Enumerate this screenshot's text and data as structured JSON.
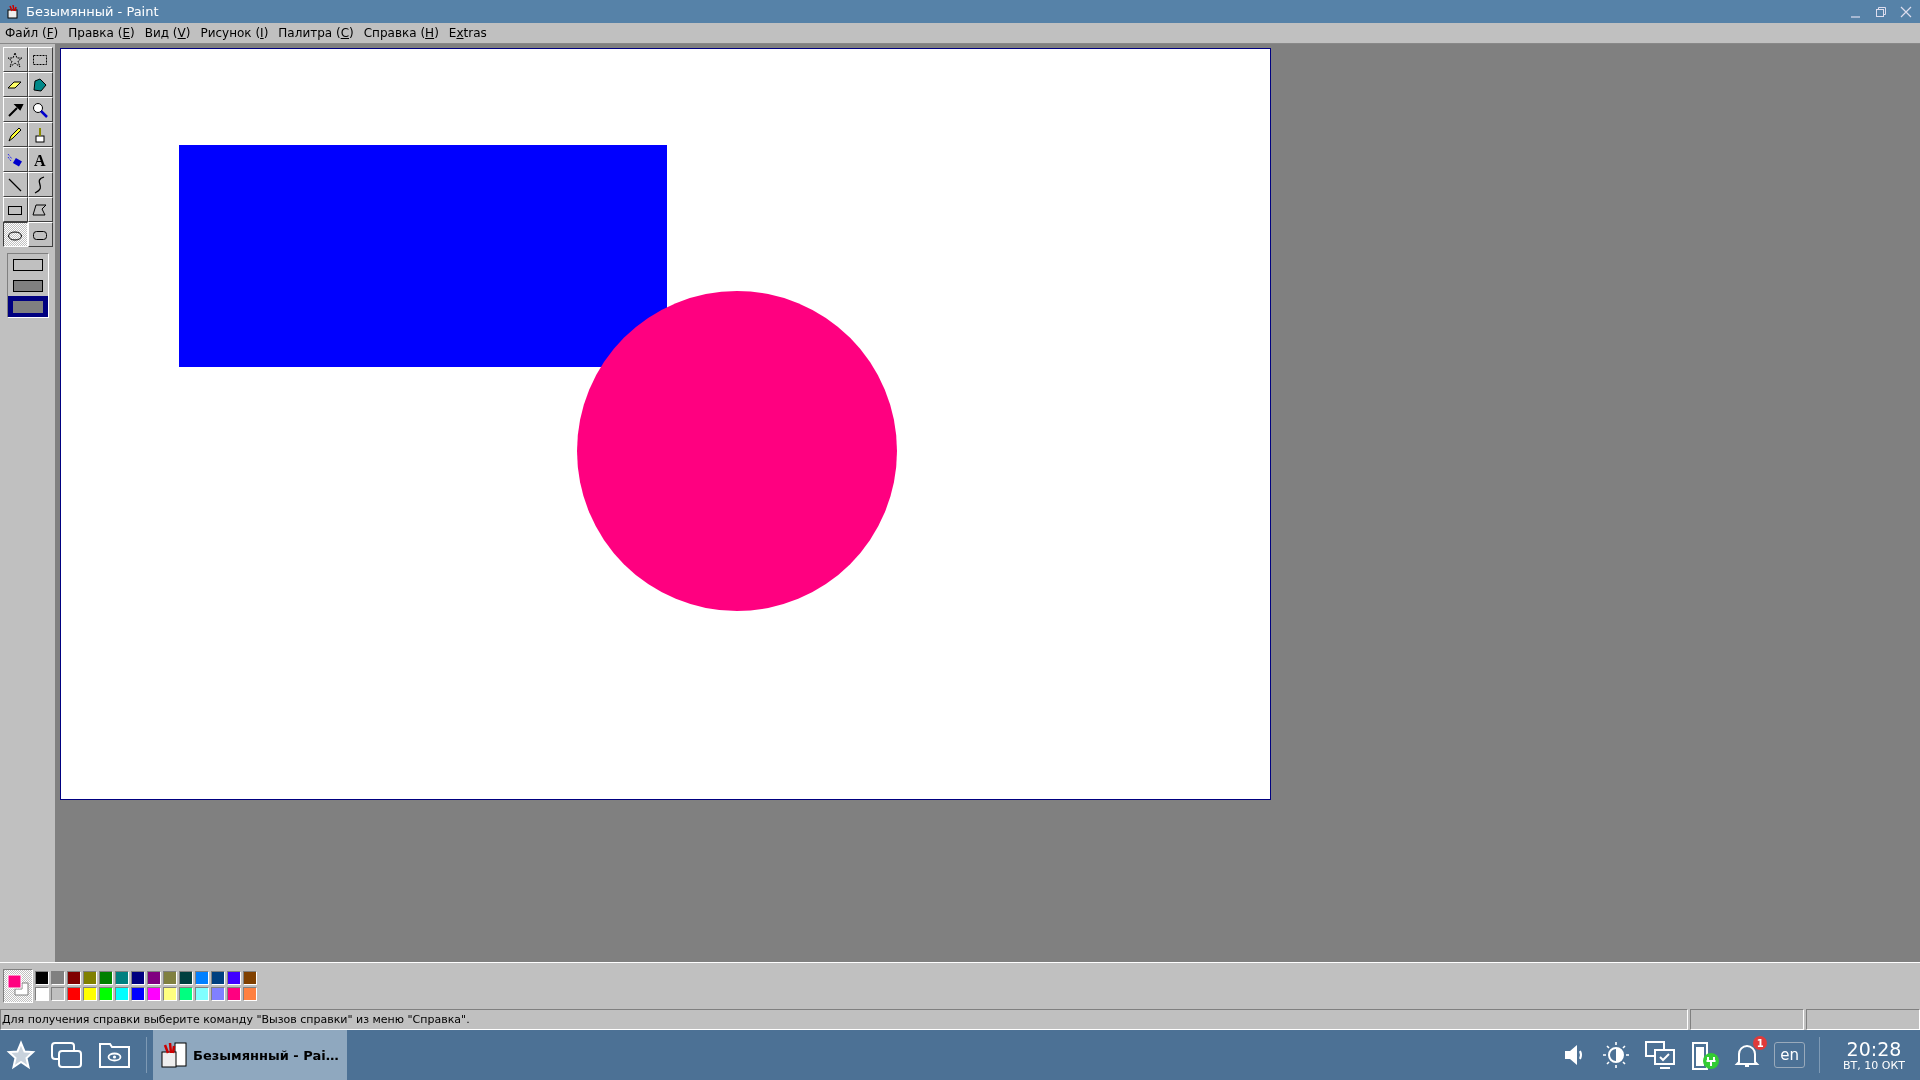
{
  "window": {
    "title": "Безымянный - Paint"
  },
  "menu": [
    {
      "before": "Файл (",
      "key": "F",
      "after": ")"
    },
    {
      "before": "Правка (",
      "key": "E",
      "after": ")"
    },
    {
      "before": "Вид (",
      "key": "V",
      "after": ")"
    },
    {
      "before": "Рисунок (",
      "key": "I",
      "after": ")"
    },
    {
      "before": "Палитра (",
      "key": "C",
      "after": ")"
    },
    {
      "before": "Справка (",
      "key": "H",
      "after": ")"
    },
    {
      "before": "E",
      "key": "x",
      "after": "tras"
    }
  ],
  "tools": [
    {
      "kind": "free-select",
      "selected": false
    },
    {
      "kind": "rect-select",
      "selected": false
    },
    {
      "kind": "eraser",
      "selected": false
    },
    {
      "kind": "fill",
      "selected": false
    },
    {
      "kind": "picker",
      "selected": false
    },
    {
      "kind": "magnifier",
      "selected": false
    },
    {
      "kind": "pencil",
      "selected": false
    },
    {
      "kind": "brush",
      "selected": false
    },
    {
      "kind": "airbrush",
      "selected": false
    },
    {
      "kind": "text",
      "selected": false,
      "glyph": "A"
    },
    {
      "kind": "line",
      "selected": false
    },
    {
      "kind": "curve",
      "selected": false
    },
    {
      "kind": "rectangle",
      "selected": false
    },
    {
      "kind": "polygon",
      "selected": false
    },
    {
      "kind": "ellipse",
      "selected": true
    },
    {
      "kind": "rounded-rect",
      "selected": false
    }
  ],
  "fill_styles": [
    {
      "kind": "outline",
      "selected": false
    },
    {
      "kind": "outline-fill",
      "selected": false
    },
    {
      "kind": "fill",
      "selected": true
    }
  ],
  "current_colors": [
    {
      "kind": "foreground",
      "color": "#ff0080"
    },
    {
      "kind": "background",
      "color": "#ffffff"
    }
  ],
  "palette": [
    {
      "color": "#000000"
    },
    {
      "color": "#808080"
    },
    {
      "color": "#800000"
    },
    {
      "color": "#808000"
    },
    {
      "color": "#008000"
    },
    {
      "color": "#008080"
    },
    {
      "color": "#000080"
    },
    {
      "color": "#800080"
    },
    {
      "color": "#808040"
    },
    {
      "color": "#004040"
    },
    {
      "color": "#0080ff"
    },
    {
      "color": "#004080"
    },
    {
      "color": "#4000ff"
    },
    {
      "color": "#804000"
    },
    {
      "color": "#ffffff"
    },
    {
      "color": "#c0c0c0"
    },
    {
      "color": "#ff0000"
    },
    {
      "color": "#ffff00"
    },
    {
      "color": "#00ff00"
    },
    {
      "color": "#00ffff"
    },
    {
      "color": "#0000ff"
    },
    {
      "color": "#ff00ff"
    },
    {
      "color": "#ffff80"
    },
    {
      "color": "#00ff80"
    },
    {
      "color": "#80ffff"
    },
    {
      "color": "#8080ff"
    },
    {
      "color": "#ff0080"
    },
    {
      "color": "#ff8040"
    }
  ],
  "status_bar": {
    "text": "Для получения справки выберите команду \"Вызов справки\" из меню \"Справка\"."
  },
  "taskbar": {
    "task": {
      "label": "Безымянный - Pai…",
      "selected": true
    },
    "notifications": "1",
    "language": "en",
    "time": "20:28",
    "date": "ВТ, 10 ОКТ"
  }
}
